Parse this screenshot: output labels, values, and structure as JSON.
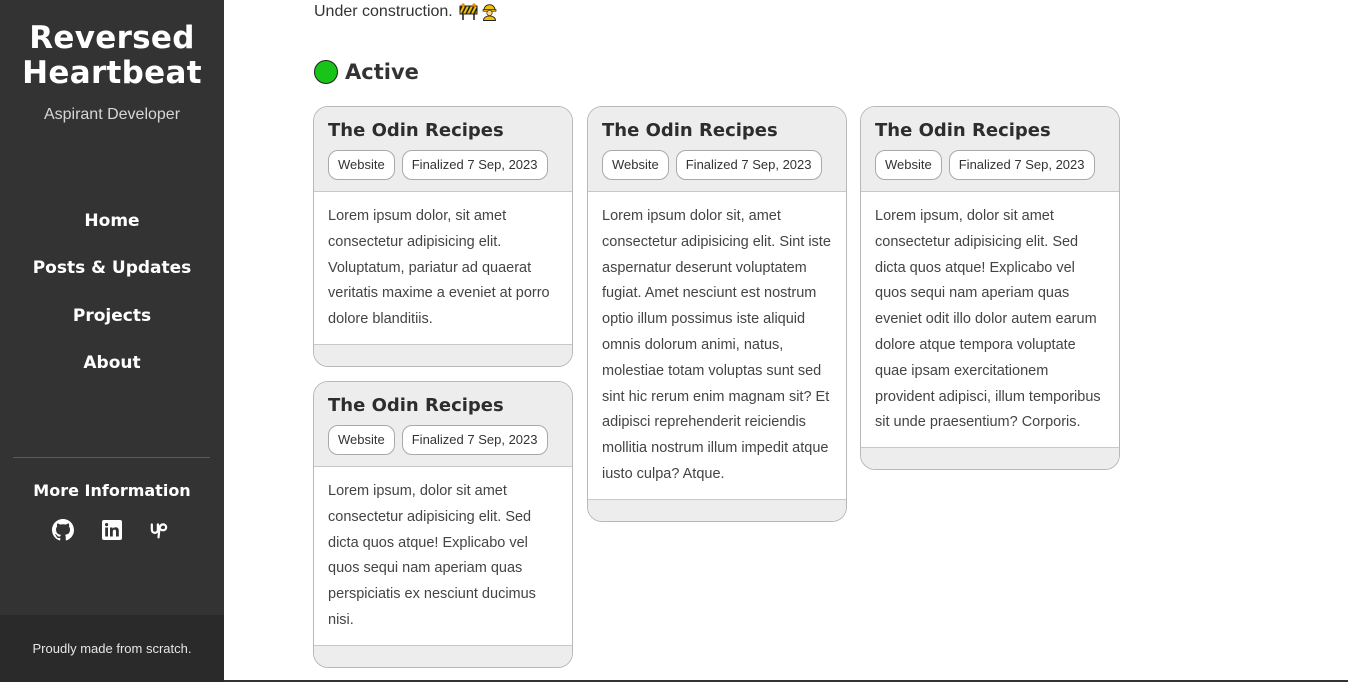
{
  "sidebar": {
    "brand_line1": "Reversed",
    "brand_line2": "Heartbeat",
    "tagline": "Aspirant Developer",
    "nav": [
      "Home",
      "Posts & Updates",
      "Projects",
      "About"
    ],
    "more_title": "More Information",
    "socials": [
      "github-icon",
      "linkedin-icon",
      "upwork-icon"
    ],
    "footer": "Proudly made from scratch."
  },
  "main": {
    "notice": "Under construction.",
    "notice_icons": [
      "construction-sign-icon",
      "construction-worker-icon"
    ],
    "section_title": "Active",
    "status_color": "#19c419",
    "cards": [
      {
        "title": "The Odin Recipes",
        "tags": [
          "Website",
          "Finalized 7 Sep, 2023"
        ],
        "body": "Lorem ipsum dolor, sit amet consectetur adipisicing elit. Voluptatum, pariatur ad quaerat veritatis maxime a eveniet at porro dolore blanditiis."
      },
      {
        "title": "The Odin Recipes",
        "tags": [
          "Website",
          "Finalized 7 Sep, 2023"
        ],
        "body": "Lorem ipsum, dolor sit amet consectetur adipisicing elit. Sed dicta quos atque! Explicabo vel quos sequi nam aperiam quas perspiciatis ex nesciunt ducimus nisi."
      },
      {
        "title": "The Odin Recipes",
        "tags": [
          "Website",
          "Finalized 7 Sep, 2023"
        ],
        "body": "Lorem ipsum dolor sit, amet consectetur adipisicing elit. Sint iste aspernatur deserunt voluptatem fugiat. Amet nesciunt est nostrum optio illum possimus iste aliquid omnis dolorum animi, natus, molestiae totam voluptas sunt sed sint hic rerum enim magnam sit? Et adipisci reprehenderit reiciendis mollitia nostrum illum impedit atque iusto culpa? Atque."
      },
      {
        "title": "The Odin Recipes",
        "tags": [
          "Website",
          "Finalized 7 Sep, 2023"
        ],
        "body": "Lorem ipsum, dolor sit amet consectetur adipisicing elit. Sed dicta quos atque! Explicabo vel quos sequi nam aperiam quas eveniet odit illo dolor autem earum dolore atque tempora voluptate quae ipsam exercitationem provident adipisci, illum temporibus sit unde praesentium? Corporis."
      }
    ]
  }
}
